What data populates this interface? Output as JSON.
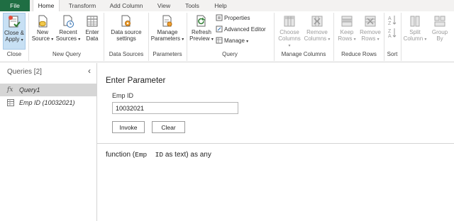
{
  "tabs": [
    "File",
    "Home",
    "Transform",
    "Add Column",
    "View",
    "Tools",
    "Help"
  ],
  "ribbon": {
    "close_apply": [
      "Close &",
      "Apply"
    ],
    "new_source": [
      "New",
      "Source"
    ],
    "recent_sources": [
      "Recent",
      "Sources"
    ],
    "enter_data": [
      "Enter",
      "Data"
    ],
    "data_source_settings": [
      "Data source",
      "settings"
    ],
    "manage_parameters": [
      "Manage",
      "Parameters"
    ],
    "refresh_preview": [
      "Refresh",
      "Preview"
    ],
    "properties": "Properties",
    "advanced_editor": "Advanced Editor",
    "manage": "Manage",
    "choose_columns": [
      "Choose",
      "Columns"
    ],
    "remove_columns": [
      "Remove",
      "Columns"
    ],
    "keep_rows": [
      "Keep",
      "Rows"
    ],
    "remove_rows": [
      "Remove",
      "Rows"
    ],
    "split_column": [
      "Split",
      "Column"
    ],
    "group_by": [
      "Group",
      "By"
    ],
    "groups": {
      "close": "Close",
      "new_query": "New Query",
      "data_sources": "Data Sources",
      "parameters": "Parameters",
      "query": "Query",
      "manage_columns": "Manage Columns",
      "reduce_rows": "Reduce Rows",
      "sort": "Sort"
    }
  },
  "queries": {
    "title": "Queries [2]",
    "items": [
      {
        "icon": "fx",
        "label": "Query1",
        "selected": true
      },
      {
        "icon": "table-icon",
        "label": "Emp ID (10032021)",
        "selected": false
      }
    ]
  },
  "main": {
    "heading": "Enter Parameter",
    "field_label": "Emp ID",
    "field_value": "10032021",
    "invoke": "Invoke",
    "clear": "Clear",
    "signature_prefix": "function (",
    "signature_param": "Emp  ID",
    "signature_suffix": " as text) as any"
  },
  "colors": {
    "file_tab": "#1f6e43",
    "selection": "#c7e0f4",
    "query_selected": "#d6d6d6",
    "disabled_text": "#9a9a9a"
  }
}
